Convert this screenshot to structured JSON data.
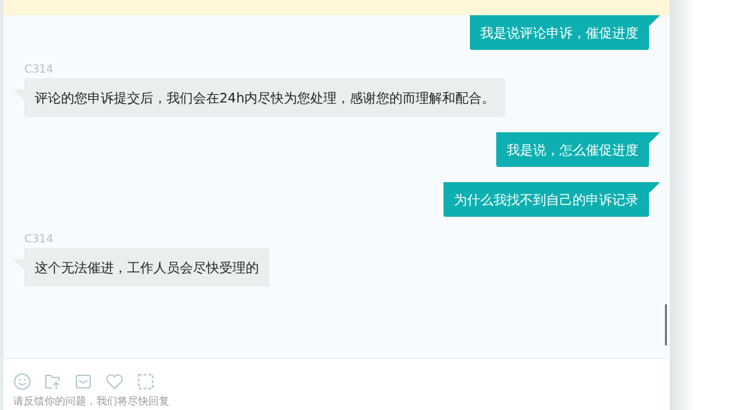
{
  "messages": [
    {
      "kind": "sent",
      "text": "我是说评论申诉，催促进度"
    },
    {
      "kind": "received",
      "sender": "C314",
      "text": "评论的您申诉提交后，我们会在24h内尽快为您处理，感谢您的而理解和配合。"
    },
    {
      "kind": "sent",
      "text": "我是说，怎么催促进度"
    },
    {
      "kind": "sent",
      "text": "为什么我找不到自己的申诉记录"
    },
    {
      "kind": "received",
      "sender": "C314",
      "text": "这个无法催进，工作人员会尽快受理的"
    }
  ],
  "composer": {
    "placeholder": "请反馈你的问题，我们将尽快回复"
  }
}
